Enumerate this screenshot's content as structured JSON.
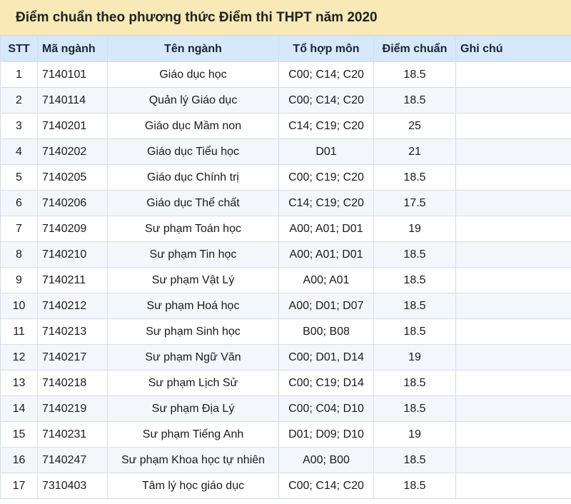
{
  "title": "Điểm chuẩn theo phương thức Điểm thi THPT năm 2020",
  "columns": [
    "STT",
    "Mã ngành",
    "Tên ngành",
    "Tổ hợp môn",
    "Điểm chuẩn",
    "Ghi chú"
  ],
  "rows": [
    {
      "stt": "1",
      "code": "7140101",
      "name": "Giáo dục học",
      "combo": "C00; C14; C20",
      "score": "18.5",
      "note": ""
    },
    {
      "stt": "2",
      "code": "7140114",
      "name": "Quản lý Giáo dục",
      "combo": "C00; C14; C20",
      "score": "18.5",
      "note": ""
    },
    {
      "stt": "3",
      "code": "7140201",
      "name": "Giáo dục Mầm non",
      "combo": "C14; C19; C20",
      "score": "25",
      "note": ""
    },
    {
      "stt": "4",
      "code": "7140202",
      "name": "Giáo dục Tiểu học",
      "combo": "D01",
      "score": "21",
      "note": ""
    },
    {
      "stt": "5",
      "code": "7140205",
      "name": "Giáo dục Chính trị",
      "combo": "C00; C19; C20",
      "score": "18.5",
      "note": ""
    },
    {
      "stt": "6",
      "code": "7140206",
      "name": "Giáo dục Thể chất",
      "combo": "C14; C19; C20",
      "score": "17.5",
      "note": ""
    },
    {
      "stt": "7",
      "code": "7140209",
      "name": "Sư phạm Toán học",
      "combo": "A00; A01; D01",
      "score": "19",
      "note": ""
    },
    {
      "stt": "8",
      "code": "7140210",
      "name": "Sư phạm Tin học",
      "combo": "A00; A01; D01",
      "score": "18.5",
      "note": ""
    },
    {
      "stt": "9",
      "code": "7140211",
      "name": "Sư phạm Vật Lý",
      "combo": "A00; A01",
      "score": "18.5",
      "note": ""
    },
    {
      "stt": "10",
      "code": "7140212",
      "name": "Sư phạm Hoá học",
      "combo": "A00; D01; D07",
      "score": "18.5",
      "note": ""
    },
    {
      "stt": "11",
      "code": "7140213",
      "name": "Sư phạm Sinh học",
      "combo": "B00; B08",
      "score": "18.5",
      "note": ""
    },
    {
      "stt": "12",
      "code": "7140217",
      "name": "Sư phạm Ngữ Văn",
      "combo": "C00; D01, D14",
      "score": "19",
      "note": ""
    },
    {
      "stt": "13",
      "code": "7140218",
      "name": "Sư phạm Lịch Sử",
      "combo": "C00; C19; D14",
      "score": "18.5",
      "note": ""
    },
    {
      "stt": "14",
      "code": "7140219",
      "name": "Sư phạm Địa Lý",
      "combo": "C00; C04; D10",
      "score": "18.5",
      "note": ""
    },
    {
      "stt": "15",
      "code": "7140231",
      "name": "Sư phạm Tiếng Anh",
      "combo": "D01; D09; D10",
      "score": "19",
      "note": ""
    },
    {
      "stt": "16",
      "code": "7140247",
      "name": "Sư phạm Khoa học tự nhiên",
      "combo": "A00; B00",
      "score": "18.5",
      "note": ""
    },
    {
      "stt": "17",
      "code": "7310403",
      "name": "Tâm lý học giáo dục",
      "combo": "C00; C14; C20",
      "score": "18.5",
      "note": ""
    }
  ]
}
